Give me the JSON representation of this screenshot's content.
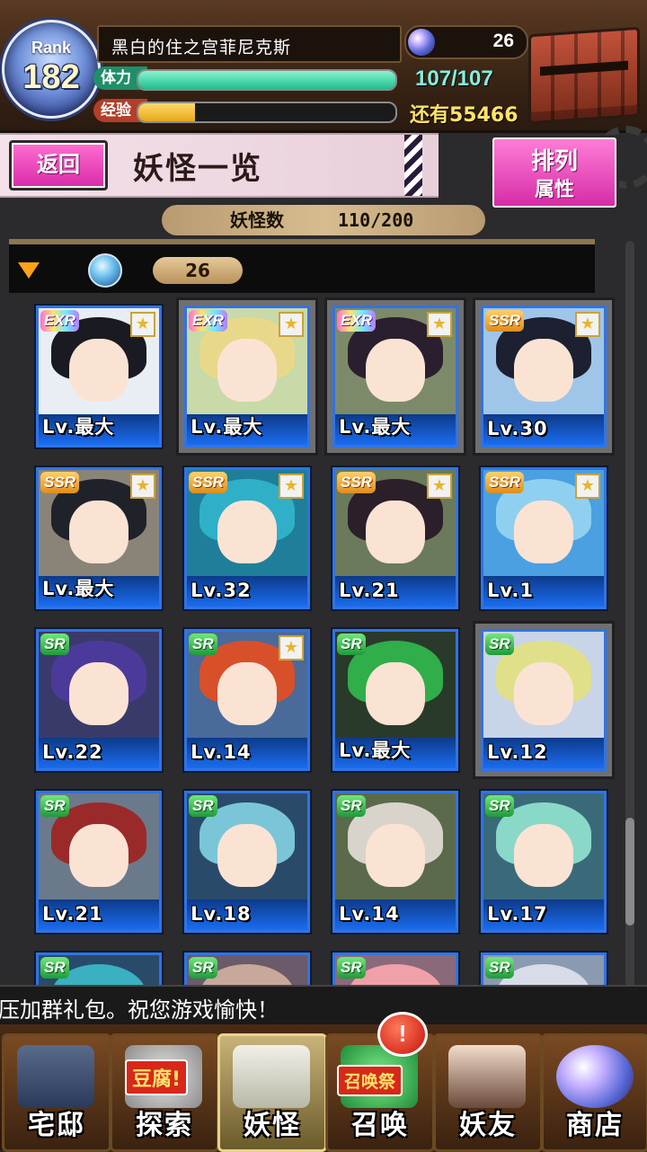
{
  "header": {
    "rank_label": "Rank",
    "rank_value": "182",
    "player_name": "黑白的住之宫菲尼克斯",
    "gem_count": "26",
    "stamina_label": "体力",
    "stamina_text": "107/107",
    "stamina_fraction": 1.0,
    "exp_label": "经验",
    "exp_text": "还有55466",
    "exp_fraction": 0.22
  },
  "titlebar": {
    "back_label": "返回",
    "page_title": "妖怪一览",
    "sort_line1": "排列",
    "sort_line2": "属性"
  },
  "count": {
    "label": "妖怪数",
    "value": "110/200"
  },
  "filter": {
    "count": "26"
  },
  "cards": [
    {
      "rarity": "EXR",
      "level": "Lv.最大",
      "star": true,
      "selected": false,
      "hair": "#1a1a22",
      "bg": "#e9eef5"
    },
    {
      "rarity": "EXR",
      "level": "Lv.最大",
      "star": true,
      "selected": true,
      "hair": "#e8d98a",
      "bg": "#c9d9a8"
    },
    {
      "rarity": "EXR",
      "level": "Lv.最大",
      "star": true,
      "selected": true,
      "hair": "#2a1f2e",
      "bg": "#7d8a6a"
    },
    {
      "rarity": "SSR",
      "level": "Lv.30",
      "star": true,
      "selected": true,
      "hair": "#1c2030",
      "bg": "#9fc6e8"
    },
    {
      "rarity": "SSR",
      "level": "Lv.最大",
      "star": true,
      "selected": false,
      "hair": "#20222a",
      "bg": "#8a8478"
    },
    {
      "rarity": "SSR",
      "level": "Lv.32",
      "star": true,
      "selected": false,
      "hair": "#2fb0c8",
      "bg": "#1f7f9a"
    },
    {
      "rarity": "SSR",
      "level": "Lv.21",
      "star": true,
      "selected": false,
      "hair": "#2b1f2a",
      "bg": "#6b7a5a"
    },
    {
      "rarity": "SSR",
      "level": "Lv.1",
      "star": true,
      "selected": false,
      "hair": "#8fd0f0",
      "bg": "#4aa0e0"
    },
    {
      "rarity": "SR",
      "level": "Lv.22",
      "star": false,
      "selected": false,
      "hair": "#4b3a9a",
      "bg": "#3a3a6a"
    },
    {
      "rarity": "SR",
      "level": "Lv.14",
      "star": true,
      "selected": false,
      "hair": "#d8502a",
      "bg": "#4a6a9a"
    },
    {
      "rarity": "SR",
      "level": "Lv.最大",
      "star": false,
      "selected": false,
      "hair": "#2fae4a",
      "bg": "#2a3a2a"
    },
    {
      "rarity": "SR",
      "level": "Lv.12",
      "star": false,
      "selected": true,
      "hair": "#e0e08a",
      "bg": "#c8d4e8"
    },
    {
      "rarity": "SR",
      "level": "Lv.21",
      "star": false,
      "selected": false,
      "hair": "#9a2a2a",
      "bg": "#6a7a8a"
    },
    {
      "rarity": "SR",
      "level": "Lv.18",
      "star": false,
      "selected": false,
      "hair": "#7ac6d8",
      "bg": "#2a4a6a"
    },
    {
      "rarity": "SR",
      "level": "Lv.14",
      "star": false,
      "selected": false,
      "hair": "#d8d4cc",
      "bg": "#5a6a4a"
    },
    {
      "rarity": "SR",
      "level": "Lv.17",
      "star": false,
      "selected": false,
      "hair": "#8ad8c8",
      "bg": "#3a6a7a"
    },
    {
      "rarity": "SR",
      "level": "",
      "star": false,
      "selected": false,
      "hair": "#3ab0c0",
      "bg": "#2a4a6a"
    },
    {
      "rarity": "SR",
      "level": "",
      "star": false,
      "selected": false,
      "hair": "#c8a89a",
      "bg": "#6a5a6a"
    },
    {
      "rarity": "SR",
      "level": "",
      "star": false,
      "selected": false,
      "hair": "#f0a0a8",
      "bg": "#8a6a7a"
    },
    {
      "rarity": "SR",
      "level": "",
      "star": false,
      "selected": false,
      "hair": "#d8dce8",
      "bg": "#8a9ab0"
    }
  ],
  "ticker": {
    "text": "压加群礼包。祝您游戏愉快！"
  },
  "nav": {
    "home": "宅邸",
    "explore": "探索",
    "explore_tag": "豆腐!",
    "yokai": "妖怪",
    "summon": "召唤",
    "summon_tag": "召唤祭",
    "friends": "妖友",
    "shop": "商店",
    "alert": "!"
  },
  "colors": {
    "accent_pink": "#d82aa8",
    "card_border": "#2f74e6",
    "stamina": "#1fbf8c",
    "exp": "#e8a81b"
  }
}
